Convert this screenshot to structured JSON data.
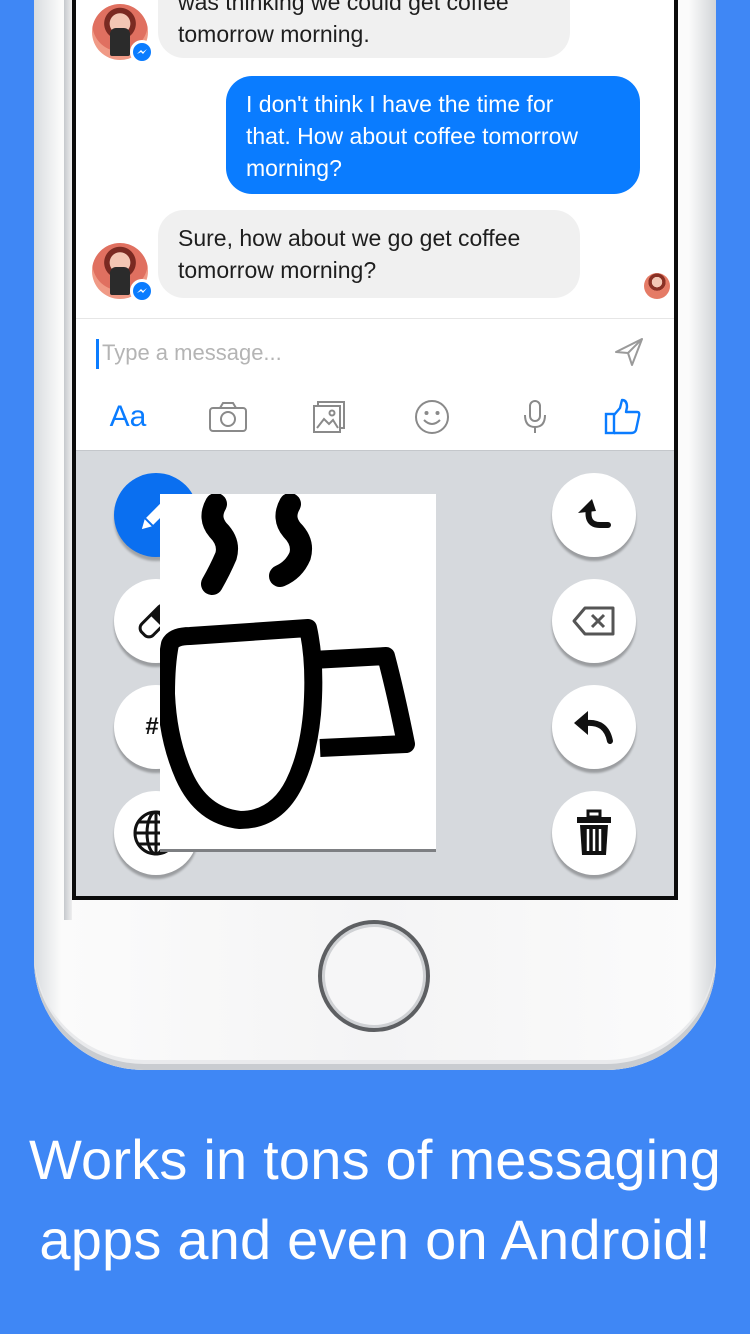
{
  "chat": {
    "messages": [
      {
        "from": "them",
        "lines": [
          "was thinking we could get coffee",
          "tomorrow morning."
        ]
      },
      {
        "from": "me",
        "lines": [
          "I don't think I have the time for",
          "that. How about coffee tomorrow",
          "morning?"
        ]
      },
      {
        "from": "them",
        "lines": [
          "Sure, how about we go get coffee",
          "tomorrow morning?"
        ]
      }
    ]
  },
  "composer": {
    "placeholder": "Type a message...",
    "aa_label": "Aa",
    "tools": [
      "camera-icon",
      "gallery-icon",
      "emoji-icon",
      "microphone-icon",
      "thumbs-up-icon"
    ]
  },
  "keyboard": {
    "left_buttons": [
      "pencil-icon",
      "eraser-icon",
      "#!",
      "globe-icon"
    ],
    "right_buttons": [
      "shift-arrow-icon",
      "backspace-icon",
      "undo-icon",
      "trash-icon"
    ],
    "symbols_label": "#!"
  },
  "colors": {
    "background": "#3f87f5",
    "messenger_blue": "#0a7cff",
    "incoming_bubble": "#f0f0f0",
    "keyboard": "#d6d9dd"
  },
  "caption": {
    "line1": "Works in tons of messaging",
    "line2": "apps and even on Android!"
  }
}
